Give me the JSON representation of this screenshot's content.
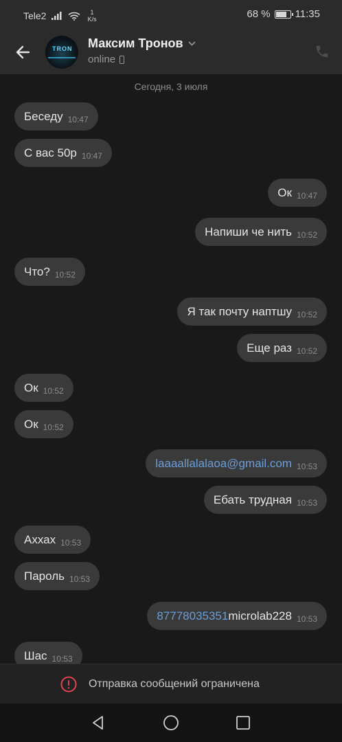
{
  "status_bar": {
    "carrier": "Tele2",
    "speed_value": "1",
    "speed_unit": "K/s",
    "battery": "68 %",
    "battery_level": 0.68,
    "time": "11:35"
  },
  "header": {
    "contact_name": "Максим Тронов",
    "status": "online",
    "avatar_text": "TRON"
  },
  "chat": {
    "date": "Сегодня, 3 июля",
    "messages": [
      {
        "dir": "in",
        "text": "Беседу",
        "time": "10:47"
      },
      {
        "dir": "in",
        "text": "С вас 50р",
        "time": "10:47"
      },
      {
        "dir": "out",
        "text": "Ок",
        "time": "10:47"
      },
      {
        "dir": "out",
        "text": "Напиши че нить",
        "time": "10:52"
      },
      {
        "dir": "in",
        "text": "Что?",
        "time": "10:52"
      },
      {
        "dir": "out",
        "text": "Я так почту наптшу",
        "time": "10:52"
      },
      {
        "dir": "out",
        "text": "Еще раз",
        "time": "10:52"
      },
      {
        "dir": "in",
        "text": "Ок",
        "time": "10:52"
      },
      {
        "dir": "in",
        "text": "Ок",
        "time": "10:52"
      },
      {
        "dir": "out",
        "link": "laaaallalalaoa@gmail.com",
        "text": "",
        "time": "10:53"
      },
      {
        "dir": "out",
        "text": "Ебать трудная",
        "time": "10:53"
      },
      {
        "dir": "in",
        "text": "Аххах",
        "time": "10:53"
      },
      {
        "dir": "in",
        "text": "Пароль",
        "time": "10:53"
      },
      {
        "dir": "out",
        "link": "87778035351",
        "text": "microlab228",
        "time": "10:53"
      },
      {
        "dir": "in",
        "text": "Шас",
        "time": "10:53"
      }
    ]
  },
  "notice": {
    "text": "Отправка сообщений ограничена",
    "icon": "error-icon",
    "color": "#e0474c"
  },
  "colors": {
    "background": "#19191a",
    "bubble": "#3a3a3b",
    "link": "#6b9ed8",
    "bar": "#2b2b2c"
  },
  "nav": {
    "icons": [
      "back-triangle-icon",
      "home-circle-icon",
      "recents-square-icon"
    ]
  }
}
